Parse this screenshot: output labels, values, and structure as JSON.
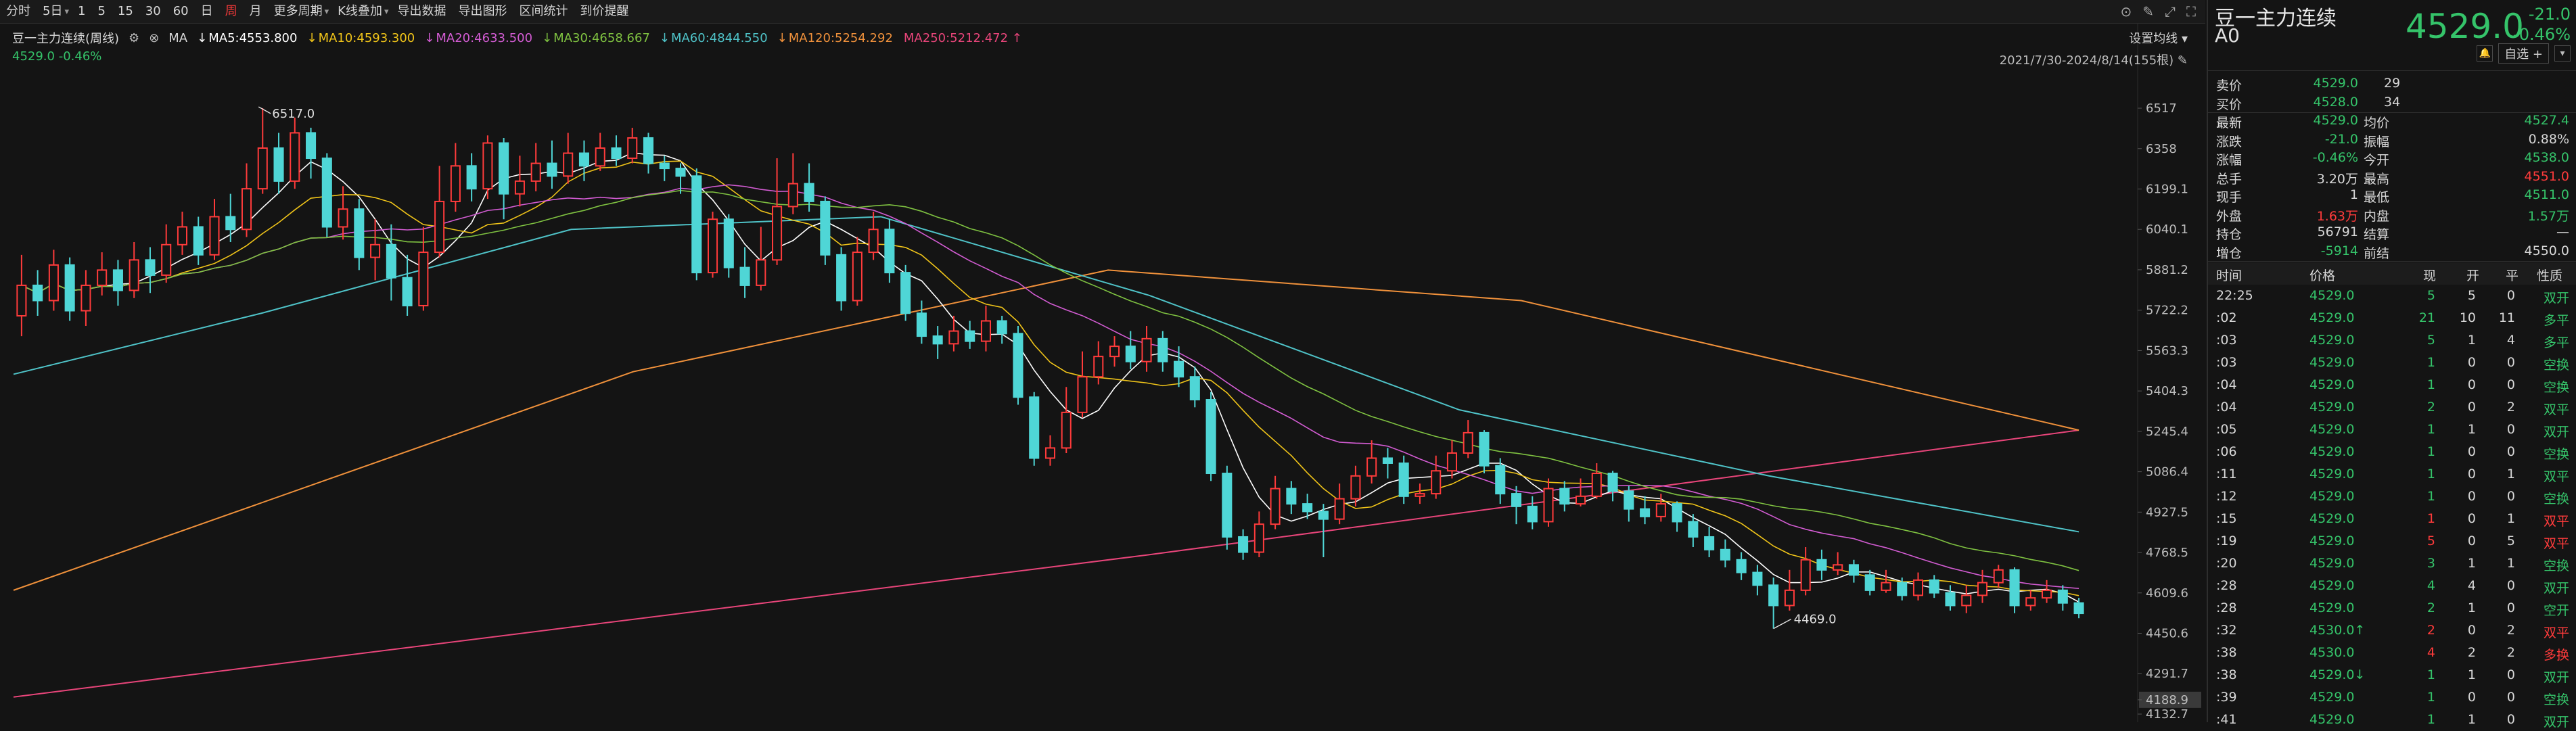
{
  "toolbar": {
    "items": [
      {
        "label": "分时",
        "active": false
      },
      {
        "label": "5日",
        "active": false,
        "dropdown": true
      },
      {
        "label": "1",
        "active": false
      },
      {
        "label": "5",
        "active": false
      },
      {
        "label": "15",
        "active": false
      },
      {
        "label": "30",
        "active": false
      },
      {
        "label": "60",
        "active": false
      },
      {
        "label": "日",
        "active": false
      },
      {
        "label": "周",
        "active": true
      },
      {
        "label": "月",
        "active": false
      },
      {
        "label": "更多周期",
        "active": false,
        "dropdown": true
      },
      {
        "label": "K线叠加",
        "active": false,
        "dropdown": true
      },
      {
        "label": "导出数据",
        "active": false
      },
      {
        "label": "导出图形",
        "active": false
      },
      {
        "label": "区间统计",
        "active": false
      },
      {
        "label": "到价提醒",
        "active": false
      }
    ]
  },
  "chart": {
    "instrument_label": "豆一主力连续(周线)",
    "ma_prefix": "MA",
    "ma": [
      {
        "label": "MA5:4553.800",
        "color": "#ffffff"
      },
      {
        "label": "MA10:4593.300",
        "color": "#f0c419"
      },
      {
        "label": "MA20:4633.500",
        "color": "#d35cd3"
      },
      {
        "label": "MA30:4658.667",
        "color": "#7fc241"
      },
      {
        "label": "MA60:4844.550",
        "color": "#4fc3c8"
      },
      {
        "label": "MA120:5254.292",
        "color": "#f0913b"
      },
      {
        "label": "MA250:5212.472",
        "color": "#e8457a"
      }
    ],
    "sub_label": "4529.0 -0.46%",
    "settings_label": "设置均线",
    "range_label": "2021/7/30-2024/8/14(155根)"
  },
  "chart_data": {
    "type": "candlestick",
    "y_axis_ticks": [
      6517.0,
      6358.0,
      6199.1,
      6040.1,
      5881.2,
      5722.2,
      5563.3,
      5404.3,
      5245.4,
      5086.4,
      4927.5,
      4768.5,
      4609.6,
      4450.6,
      4291.7,
      4188.9,
      4132.7
    ],
    "ylim": [
      4132.7,
      6676.0
    ],
    "highlighted_tick": 4188.9,
    "high_marker": {
      "label": "6517.0",
      "value": 6517.0
    },
    "low_marker": {
      "label": "4469.0",
      "value": 4469.0
    },
    "colors": {
      "up": "#ff3b3b",
      "down": "#4fd6d6"
    },
    "candles": [
      [
        5700,
        5820,
        5940,
        5620
      ],
      [
        5820,
        5760,
        5880,
        5700
      ],
      [
        5760,
        5900,
        5960,
        5720
      ],
      [
        5900,
        5720,
        5930,
        5680
      ],
      [
        5720,
        5820,
        5880,
        5660
      ],
      [
        5820,
        5880,
        5950,
        5780
      ],
      [
        5880,
        5800,
        5920,
        5740
      ],
      [
        5800,
        5920,
        5990,
        5770
      ],
      [
        5920,
        5860,
        5970,
        5790
      ],
      [
        5860,
        5980,
        6060,
        5830
      ],
      [
        5980,
        6050,
        6110,
        5940
      ],
      [
        6050,
        5940,
        6090,
        5900
      ],
      [
        5940,
        6090,
        6160,
        5920
      ],
      [
        6090,
        6040,
        6180,
        5990
      ],
      [
        6040,
        6200,
        6300,
        6010
      ],
      [
        6200,
        6360,
        6517,
        6180
      ],
      [
        6360,
        6230,
        6420,
        6180
      ],
      [
        6230,
        6420,
        6480,
        6200
      ],
      [
        6420,
        6320,
        6440,
        6240
      ],
      [
        6320,
        6050,
        6340,
        6010
      ],
      [
        6050,
        6120,
        6210,
        6000
      ],
      [
        6120,
        5930,
        6160,
        5880
      ],
      [
        5930,
        5980,
        6080,
        5840
      ],
      [
        5980,
        5850,
        6060,
        5760
      ],
      [
        5850,
        5740,
        5940,
        5700
      ],
      [
        5740,
        5950,
        6050,
        5720
      ],
      [
        5950,
        6150,
        6290,
        5930
      ],
      [
        6150,
        6290,
        6380,
        6110
      ],
      [
        6290,
        6200,
        6340,
        6150
      ],
      [
        6200,
        6380,
        6410,
        6160
      ],
      [
        6380,
        6180,
        6400,
        6080
      ],
      [
        6180,
        6230,
        6330,
        6130
      ],
      [
        6230,
        6300,
        6380,
        6190
      ],
      [
        6300,
        6250,
        6390,
        6200
      ],
      [
        6250,
        6340,
        6420,
        6220
      ],
      [
        6340,
        6290,
        6390,
        6230
      ],
      [
        6290,
        6360,
        6420,
        6270
      ],
      [
        6360,
        6320,
        6410,
        6290
      ],
      [
        6320,
        6400,
        6440,
        6300
      ],
      [
        6400,
        6300,
        6420,
        6260
      ],
      [
        6300,
        6280,
        6330,
        6230
      ],
      [
        6280,
        6250,
        6300,
        6180
      ],
      [
        6250,
        5870,
        6280,
        5840
      ],
      [
        5870,
        6080,
        6110,
        5850
      ],
      [
        6080,
        5890,
        6100,
        5850
      ],
      [
        5890,
        5820,
        5970,
        5770
      ],
      [
        5820,
        5920,
        6050,
        5800
      ],
      [
        5920,
        6130,
        6320,
        5900
      ],
      [
        6130,
        6220,
        6340,
        6100
      ],
      [
        6220,
        6150,
        6300,
        6110
      ],
      [
        6150,
        5940,
        6170,
        5900
      ],
      [
        5940,
        5760,
        5970,
        5720
      ],
      [
        5760,
        5950,
        6010,
        5740
      ],
      [
        5950,
        6040,
        6110,
        5920
      ],
      [
        6040,
        5870,
        6080,
        5830
      ],
      [
        5870,
        5710,
        5900,
        5680
      ],
      [
        5710,
        5620,
        5760,
        5590
      ],
      [
        5620,
        5590,
        5660,
        5530
      ],
      [
        5590,
        5640,
        5700,
        5560
      ],
      [
        5640,
        5600,
        5680,
        5570
      ],
      [
        5600,
        5680,
        5740,
        5560
      ],
      [
        5680,
        5630,
        5700,
        5590
      ],
      [
        5630,
        5380,
        5660,
        5350
      ],
      [
        5380,
        5140,
        5400,
        5110
      ],
      [
        5140,
        5180,
        5230,
        5110
      ],
      [
        5180,
        5320,
        5420,
        5160
      ],
      [
        5320,
        5460,
        5560,
        5300
      ],
      [
        5460,
        5540,
        5600,
        5430
      ],
      [
        5540,
        5580,
        5620,
        5500
      ],
      [
        5580,
        5520,
        5640,
        5490
      ],
      [
        5520,
        5610,
        5660,
        5480
      ],
      [
        5610,
        5520,
        5640,
        5480
      ],
      [
        5520,
        5460,
        5580,
        5420
      ],
      [
        5460,
        5370,
        5500,
        5340
      ],
      [
        5370,
        5080,
        5400,
        5050
      ],
      [
        5080,
        4830,
        5110,
        4780
      ],
      [
        4830,
        4770,
        4860,
        4740
      ],
      [
        4770,
        4880,
        4930,
        4750
      ],
      [
        4880,
        5020,
        5070,
        4860
      ],
      [
        5020,
        4960,
        5050,
        4920
      ],
      [
        4960,
        4930,
        5000,
        4900
      ],
      [
        4930,
        4900,
        4960,
        4750
      ],
      [
        4900,
        4980,
        5040,
        4880
      ],
      [
        4980,
        5070,
        5110,
        4950
      ],
      [
        5070,
        5140,
        5210,
        5040
      ],
      [
        5140,
        5120,
        5180,
        5060
      ],
      [
        5120,
        4990,
        5150,
        4960
      ],
      [
        4990,
        5000,
        5040,
        4960
      ],
      [
        5000,
        5090,
        5150,
        4980
      ],
      [
        5090,
        5160,
        5210,
        5060
      ],
      [
        5160,
        5240,
        5290,
        5140
      ],
      [
        5240,
        5110,
        5250,
        5080
      ],
      [
        5110,
        5000,
        5140,
        4960
      ],
      [
        5000,
        4950,
        5030,
        4880
      ],
      [
        4950,
        4890,
        4990,
        4860
      ],
      [
        4890,
        5020,
        5060,
        4870
      ],
      [
        5020,
        4960,
        5050,
        4930
      ],
      [
        4960,
        4990,
        5060,
        4950
      ],
      [
        4990,
        5080,
        5120,
        4980
      ],
      [
        5080,
        5010,
        5090,
        4970
      ],
      [
        5010,
        4940,
        5030,
        4890
      ],
      [
        4940,
        4910,
        4990,
        4880
      ],
      [
        4910,
        4960,
        5000,
        4890
      ],
      [
        4960,
        4890,
        4970,
        4850
      ],
      [
        4890,
        4830,
        4920,
        4790
      ],
      [
        4830,
        4780,
        4870,
        4750
      ],
      [
        4780,
        4740,
        4820,
        4710
      ],
      [
        4740,
        4690,
        4770,
        4660
      ],
      [
        4690,
        4640,
        4720,
        4600
      ],
      [
        4640,
        4560,
        4670,
        4469
      ],
      [
        4560,
        4620,
        4700,
        4540
      ],
      [
        4620,
        4740,
        4790,
        4600
      ],
      [
        4740,
        4700,
        4780,
        4660
      ],
      [
        4700,
        4720,
        4770,
        4680
      ],
      [
        4720,
        4680,
        4740,
        4650
      ],
      [
        4680,
        4620,
        4700,
        4600
      ],
      [
        4620,
        4650,
        4700,
        4610
      ],
      [
        4650,
        4600,
        4670,
        4580
      ],
      [
        4600,
        4660,
        4690,
        4580
      ],
      [
        4660,
        4610,
        4680,
        4590
      ],
      [
        4610,
        4560,
        4640,
        4540
      ],
      [
        4560,
        4600,
        4640,
        4530
      ],
      [
        4600,
        4650,
        4700,
        4570
      ],
      [
        4650,
        4700,
        4720,
        4630
      ],
      [
        4700,
        4560,
        4710,
        4530
      ],
      [
        4560,
        4590,
        4620,
        4540
      ],
      [
        4590,
        4620,
        4660,
        4570
      ],
      [
        4620,
        4570,
        4640,
        4540
      ],
      [
        4570,
        4529,
        4590,
        4510
      ]
    ],
    "ma_series": [
      {
        "name": "MA250",
        "color": "#e8457a",
        "points": [
          [
            0,
            4200
          ],
          [
            0.55,
            4760
          ],
          [
            1,
            5250
          ]
        ]
      },
      {
        "name": "MA120",
        "color": "#f0913b",
        "points": [
          [
            0,
            4620
          ],
          [
            0.3,
            5480
          ],
          [
            0.53,
            5880
          ],
          [
            0.73,
            5760
          ],
          [
            1,
            5250
          ]
        ]
      },
      {
        "name": "MA60",
        "color": "#4fc3c8",
        "points": [
          [
            0,
            5470
          ],
          [
            0.12,
            5710
          ],
          [
            0.27,
            6040
          ],
          [
            0.42,
            6090
          ],
          [
            0.55,
            5780
          ],
          [
            0.7,
            5330
          ],
          [
            0.85,
            5070
          ],
          [
            1,
            4850
          ]
        ]
      }
    ]
  },
  "quote": {
    "title": "豆一主力连续",
    "code": "A0",
    "price": "4529.0",
    "change": "-21.0",
    "change_pct": "-0.46%",
    "btn_watch": "自选 +",
    "rows": [
      {
        "l1": "卖价",
        "v1": "4529.0",
        "c1": "g",
        "v1b": "29",
        "c1b": "w",
        "l2": "",
        "v2": "",
        "c2": "w"
      },
      {
        "l1": "买价",
        "v1": "4528.0",
        "c1": "g",
        "v1b": "34",
        "c1b": "w",
        "l2": "",
        "v2": "",
        "c2": "w"
      },
      {
        "l1": "最新",
        "v1": "4529.0",
        "c1": "g",
        "l2": "均价",
        "v2": "4527.4",
        "c2": "g"
      },
      {
        "l1": "涨跌",
        "v1": "-21.0",
        "c1": "g",
        "l2": "振幅",
        "v2": "0.88%",
        "c2": "w"
      },
      {
        "l1": "涨幅",
        "v1": "-0.46%",
        "c1": "g",
        "l2": "今开",
        "v2": "4538.0",
        "c2": "g"
      },
      {
        "l1": "总手",
        "v1": "3.20万",
        "c1": "w",
        "l2": "最高",
        "v2": "4551.0",
        "c2": "r"
      },
      {
        "l1": "现手",
        "v1": "1",
        "c1": "w",
        "l2": "最低",
        "v2": "4511.0",
        "c2": "g"
      },
      {
        "l1": "外盘",
        "v1": "1.63万",
        "c1": "r",
        "l2": "内盘",
        "v2": "1.57万",
        "c2": "g"
      },
      {
        "l1": "持仓",
        "v1": "56791",
        "c1": "w",
        "l2": "结算",
        "v2": "—",
        "c2": "w"
      },
      {
        "l1": "增仓",
        "v1": "-5914",
        "c1": "g",
        "l2": "前结",
        "v2": "4550.0",
        "c2": "w"
      }
    ],
    "trade_headers": [
      "时间",
      "价格",
      "现",
      "开",
      "平",
      "性质"
    ],
    "trades": [
      {
        "t": "22:25",
        "p": "4529.0",
        "pc": "g",
        "v": "5",
        "vc": "g",
        "o": "5",
        "c": "0",
        "n": "双开",
        "nc": "g"
      },
      {
        "t": ":02",
        "p": "4529.0",
        "pc": "g",
        "v": "21",
        "vc": "g",
        "o": "10",
        "c": "11",
        "n": "多平",
        "nc": "g"
      },
      {
        "t": ":03",
        "p": "4529.0",
        "pc": "g",
        "v": "5",
        "vc": "g",
        "o": "1",
        "c": "4",
        "n": "多平",
        "nc": "g"
      },
      {
        "t": ":03",
        "p": "4529.0",
        "pc": "g",
        "v": "1",
        "vc": "g",
        "o": "0",
        "c": "0",
        "n": "空换",
        "nc": "g"
      },
      {
        "t": ":04",
        "p": "4529.0",
        "pc": "g",
        "v": "1",
        "vc": "g",
        "o": "0",
        "c": "0",
        "n": "空换",
        "nc": "g"
      },
      {
        "t": ":04",
        "p": "4529.0",
        "pc": "g",
        "v": "2",
        "vc": "g",
        "o": "0",
        "c": "2",
        "n": "双平",
        "nc": "g"
      },
      {
        "t": ":05",
        "p": "4529.0",
        "pc": "g",
        "v": "1",
        "vc": "g",
        "o": "1",
        "c": "0",
        "n": "双开",
        "nc": "g"
      },
      {
        "t": ":06",
        "p": "4529.0",
        "pc": "g",
        "v": "1",
        "vc": "g",
        "o": "0",
        "c": "0",
        "n": "空换",
        "nc": "g"
      },
      {
        "t": ":11",
        "p": "4529.0",
        "pc": "g",
        "v": "1",
        "vc": "g",
        "o": "0",
        "c": "1",
        "n": "双平",
        "nc": "g"
      },
      {
        "t": ":12",
        "p": "4529.0",
        "pc": "g",
        "v": "1",
        "vc": "g",
        "o": "0",
        "c": "0",
        "n": "空换",
        "nc": "g"
      },
      {
        "t": ":15",
        "p": "4529.0",
        "pc": "g",
        "v": "1",
        "vc": "r",
        "o": "0",
        "c": "1",
        "n": "双平",
        "nc": "r"
      },
      {
        "t": ":19",
        "p": "4529.0",
        "pc": "g",
        "v": "5",
        "vc": "r",
        "o": "0",
        "c": "5",
        "n": "双平",
        "nc": "r"
      },
      {
        "t": ":20",
        "p": "4529.0",
        "pc": "g",
        "v": "3",
        "vc": "g",
        "o": "1",
        "c": "1",
        "n": "空换",
        "nc": "g"
      },
      {
        "t": ":28",
        "p": "4529.0",
        "pc": "g",
        "v": "4",
        "vc": "g",
        "o": "4",
        "c": "0",
        "n": "双开",
        "nc": "g"
      },
      {
        "t": ":28",
        "p": "4529.0",
        "pc": "g",
        "v": "2",
        "vc": "g",
        "o": "1",
        "c": "0",
        "n": "空开",
        "nc": "g"
      },
      {
        "t": ":32",
        "p": "4530.0↑",
        "pc": "g",
        "v": "2",
        "vc": "r",
        "o": "0",
        "c": "2",
        "n": "双平",
        "nc": "r"
      },
      {
        "t": ":38",
        "p": "4530.0",
        "pc": "g",
        "v": "4",
        "vc": "r",
        "o": "2",
        "c": "2",
        "n": "多换",
        "nc": "r"
      },
      {
        "t": ":38",
        "p": "4529.0↓",
        "pc": "g",
        "v": "1",
        "vc": "g",
        "o": "1",
        "c": "0",
        "n": "双开",
        "nc": "g"
      },
      {
        "t": ":39",
        "p": "4529.0",
        "pc": "g",
        "v": "1",
        "vc": "g",
        "o": "0",
        "c": "0",
        "n": "空换",
        "nc": "g"
      },
      {
        "t": ":41",
        "p": "4529.0",
        "pc": "g",
        "v": "1",
        "vc": "g",
        "o": "1",
        "c": "0",
        "n": "双开",
        "nc": "g"
      }
    ]
  }
}
